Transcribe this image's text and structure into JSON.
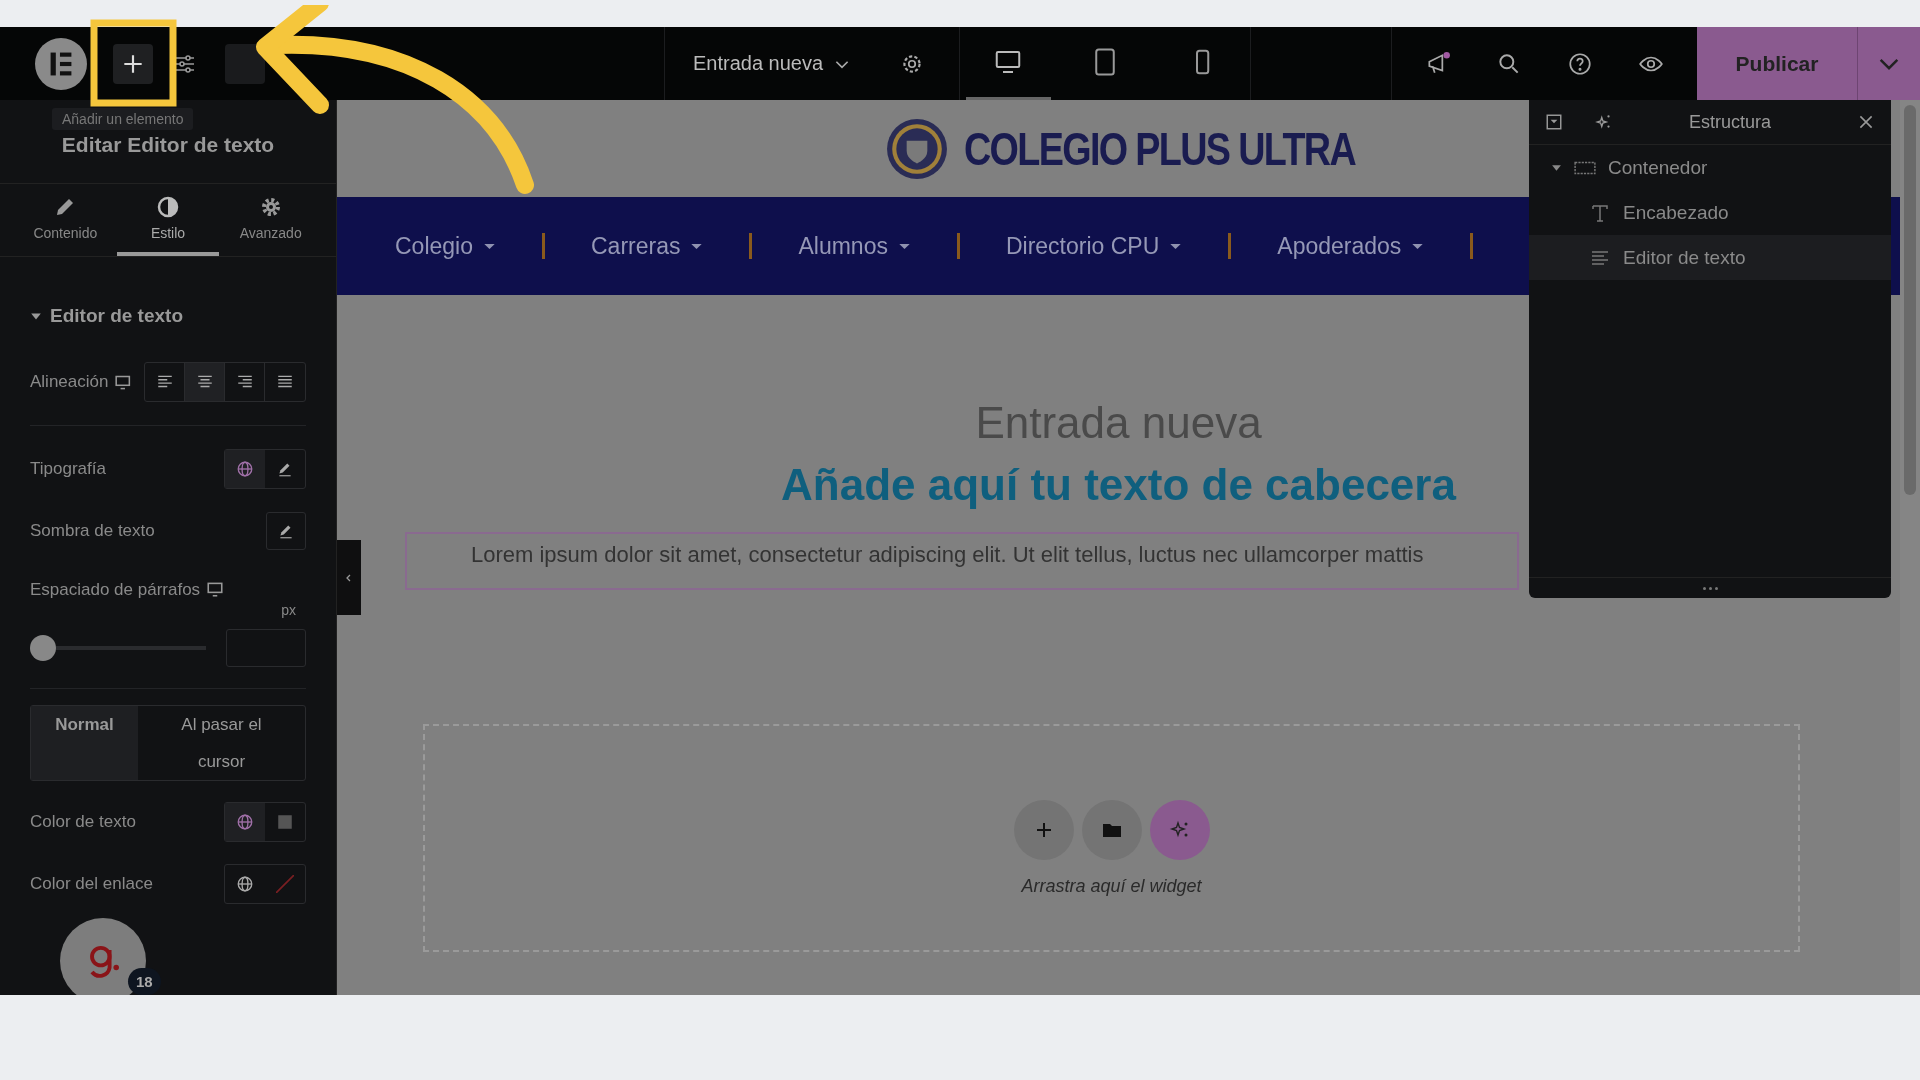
{
  "topbar": {
    "add_tooltip": "Añadir un elemento",
    "page_title": "Entrada nueva",
    "devices": [
      {
        "kind": "desktop",
        "selected": true
      },
      {
        "kind": "tablet",
        "selected": false
      },
      {
        "kind": "mobile",
        "selected": false
      }
    ],
    "has_notification": true,
    "publish": "Publicar"
  },
  "panel": {
    "title": "Editar Editor de texto",
    "tabs": [
      {
        "kind": "content",
        "label": "Contenido",
        "selected": false
      },
      {
        "kind": "style",
        "label": "Estilo",
        "selected": true
      },
      {
        "kind": "advanced",
        "label": "Avanzado",
        "selected": false
      }
    ],
    "section": {
      "title": "Editor de texto",
      "expanded": true
    },
    "alignment": {
      "label": "Alineación",
      "options": [
        {
          "kind": "left",
          "selected": false
        },
        {
          "kind": "center",
          "selected": true
        },
        {
          "kind": "right",
          "selected": false
        },
        {
          "kind": "justify",
          "selected": false
        }
      ]
    },
    "typography": {
      "label": "Tipografía",
      "global_active": true
    },
    "text_shadow": {
      "label": "Sombra de texto"
    },
    "paragraph_spacing": {
      "label": "Espaciado de párrafos",
      "unit": "px",
      "level": 0
    },
    "state_tabs": [
      {
        "label": "Normal",
        "selected": true
      },
      {
        "label": "Al pasar el cursor",
        "selected": false
      }
    ],
    "colors": [
      {
        "label": "Color de texto",
        "global_active": true,
        "empty": false
      },
      {
        "label": "Color del enlace",
        "global_active": false,
        "empty": true
      }
    ]
  },
  "helper": {
    "badge": "18"
  },
  "site": {
    "title": "COLEGIO PLUS ULTRA",
    "nav": [
      "Colegio",
      "Carreras",
      "Alumnos",
      "Directorio CPU",
      "Apoderados"
    ],
    "heading": "Entrada nueva",
    "subheading": "Añade aquí tu texto de cabecera",
    "paragraph": "Lorem ipsum dolor sit amet, consectetur adipiscing elit. Ut elit tellus, luctus nec ullamcorper mattis",
    "dropzone_hint": "Arrastra aquí el widget"
  },
  "structure": {
    "title": "Estructura",
    "tree": [
      {
        "label": "Contenedor",
        "kind": "container",
        "expanded": true,
        "selected": false,
        "children": [
          {
            "label": "Encabezado",
            "kind": "heading",
            "selected": false
          },
          {
            "label": "Editor de texto",
            "kind": "text",
            "selected": true
          }
        ]
      }
    ]
  }
}
